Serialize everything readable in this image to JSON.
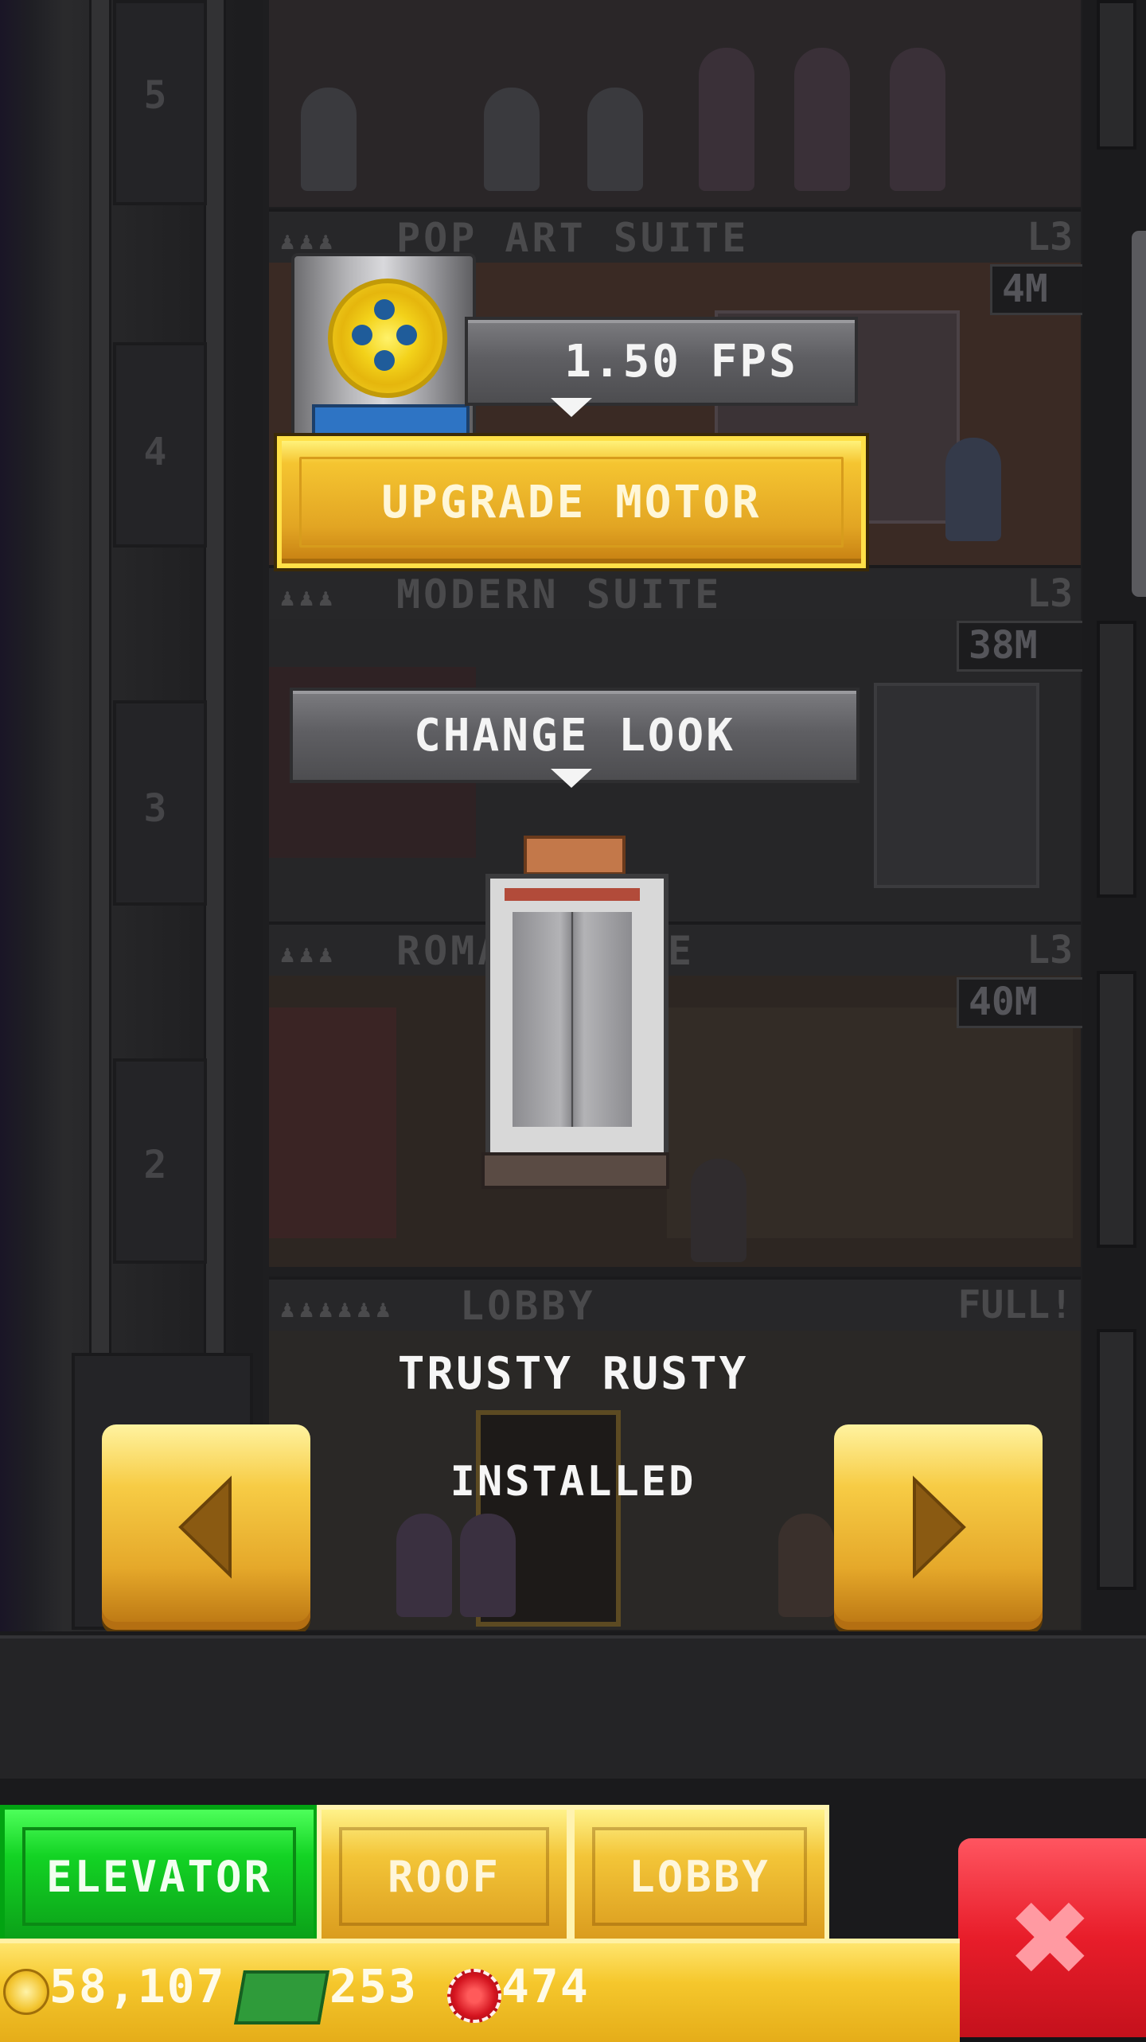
{
  "shaft": {
    "floor_numbers": [
      "5",
      "4",
      "3",
      "2"
    ]
  },
  "floors": {
    "pop_art": {
      "name": "POP ART SUITE",
      "level": "L3",
      "badge": "4M"
    },
    "modern": {
      "name": "MODERN SUITE",
      "level": "L3",
      "badge": "38M"
    },
    "roman": {
      "name": "ROMAN SUITE",
      "level": "L3",
      "badge": "40M"
    },
    "lobby": {
      "name": "LOBBY",
      "level": "FULL!"
    }
  },
  "elevator": {
    "speed_label": "1.50 FPS",
    "upgrade_label": "UPGRADE MOTOR",
    "change_look_label": "CHANGE LOOK",
    "look_name": "TRUSTY RUSTY",
    "look_status": "INSTALLED"
  },
  "tabs": [
    {
      "label": "ELEVATOR",
      "active": true
    },
    {
      "label": "ROOF",
      "active": false
    },
    {
      "label": "LOBBY",
      "active": false
    }
  ],
  "currency": {
    "coins": "58,107",
    "bux": "253",
    "tokens": "474"
  },
  "icons": {
    "prev": "left-arrow-icon",
    "next": "right-arrow-icon",
    "close": "close-icon",
    "coin": "coin-icon",
    "bux": "bux-icon",
    "token": "token-icon",
    "motor": "elevator-motor-icon"
  },
  "colors": {
    "active_tab": "#13d324",
    "gold": "#f5c531",
    "close": "#e81d2a"
  }
}
